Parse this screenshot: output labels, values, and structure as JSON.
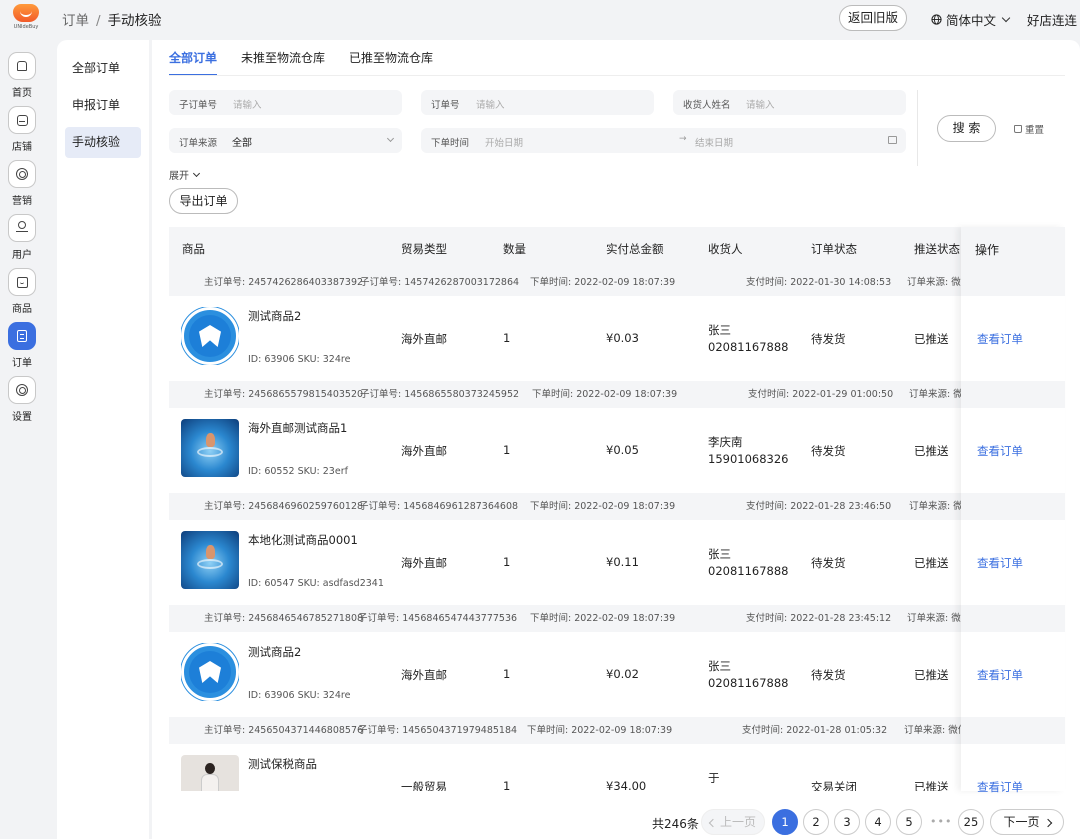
{
  "header": {
    "logo_text": "UNIdeBuy",
    "breadcrumb": [
      "订单",
      "手动核验"
    ],
    "old_version_label": "返回旧版",
    "language_label": "简体中文",
    "store_label": "好店连连"
  },
  "rail": {
    "items": [
      {
        "label": "首页",
        "icon": "house-icon"
      },
      {
        "label": "店铺",
        "icon": "store-icon"
      },
      {
        "label": "营销",
        "icon": "target-icon"
      },
      {
        "label": "用户",
        "icon": "user-icon"
      },
      {
        "label": "商品",
        "icon": "bag-icon"
      },
      {
        "label": "订单",
        "icon": "order-icon",
        "active": true
      },
      {
        "label": "设置",
        "icon": "settings-icon"
      }
    ]
  },
  "subnav": {
    "items": [
      "全部订单",
      "申报订单",
      "手动核验"
    ],
    "active_index": 2
  },
  "tabs": [
    "全部订单",
    "未推至物流仓库",
    "已推至物流仓库"
  ],
  "filters": {
    "sub_order_label": "子订单号",
    "sub_order_placeholder": "请输入",
    "order_label": "订单号",
    "order_placeholder": "请输入",
    "receiver_label": "收货人姓名",
    "receiver_placeholder": "请输入",
    "source_label": "订单来源",
    "source_value": "全部",
    "time_label": "下单时间",
    "start_placeholder": "开始日期",
    "end_placeholder": "结束日期",
    "range_arrow": "→",
    "search_label": "搜 索",
    "reset_label": "重置",
    "expand_label": "展开",
    "export_label": "导出订单"
  },
  "table": {
    "columns": [
      "商品",
      "贸易类型",
      "数量",
      "实付总金额",
      "收货人",
      "订单状态",
      "推送状态",
      "操作"
    ],
    "orders": [
      {
        "meta": {
          "main": "主订单号: 2457426286403387392",
          "sub": "子订单号: 1457426287003172864",
          "created": "下单时间: 2022-02-09 18:07:39",
          "paid": "支付时间: 2022-01-30 14:08:53",
          "source": "订单来源: 微信"
        },
        "product": "测试商品2",
        "thumb": "shield",
        "ids": "ID: 63906  SKU: 324re",
        "trade": "海外直邮",
        "qty": "1",
        "amount": "¥0.03",
        "receiver_name": "张三",
        "receiver_phone": "02081167888",
        "status": "待发货",
        "push": "已推送",
        "action": "查看订单"
      },
      {
        "meta": {
          "main": "主订单号: 2456865579815403520",
          "sub": "子订单号: 1456865580373245952",
          "created": "下单时间: 2022-02-09 18:07:39",
          "paid": "支付时间: 2022-01-29 01:00:50",
          "source": "订单来源: 微信"
        },
        "product": "海外直邮测试商品1",
        "thumb": "water",
        "ids": "ID: 60552  SKU: 23erf",
        "trade": "海外直邮",
        "qty": "1",
        "amount": "¥0.05",
        "receiver_name": "李庆南",
        "receiver_phone": "15901068326",
        "status": "待发货",
        "push": "已推送",
        "action": "查看订单"
      },
      {
        "meta": {
          "main": "主订单号: 2456846960259760128",
          "sub": "子订单号: 1456846961287364608",
          "created": "下单时间: 2022-02-09 18:07:39",
          "paid": "支付时间: 2022-01-28 23:46:50",
          "source": "订单来源: 微信"
        },
        "product": "本地化测试商品0001",
        "thumb": "water",
        "ids": "ID: 60547  SKU: asdfasd2341",
        "trade": "海外直邮",
        "qty": "1",
        "amount": "¥0.11",
        "receiver_name": "张三",
        "receiver_phone": "02081167888",
        "status": "待发货",
        "push": "已推送",
        "action": "查看订单"
      },
      {
        "meta": {
          "main": "主订单号: 2456846546785271808",
          "sub": "子订单号: 1456846547443777536",
          "created": "下单时间: 2022-02-09 18:07:39",
          "paid": "支付时间: 2022-01-28 23:45:12",
          "source": "订单来源: 微信"
        },
        "product": "测试商品2",
        "thumb": "shield",
        "ids": "ID: 63906  SKU: 324re",
        "trade": "海外直邮",
        "qty": "1",
        "amount": "¥0.02",
        "receiver_name": "张三",
        "receiver_phone": "02081167888",
        "status": "待发货",
        "push": "已推送",
        "action": "查看订单"
      },
      {
        "meta": {
          "main": "主订单号: 2456504371446808576",
          "sub": "子订单号: 1456504371979485184",
          "created": "下单时间: 2022-02-09 18:07:39",
          "paid": "支付时间: 2022-01-28 01:05:32",
          "source": "订单来源: 微信"
        },
        "product": "测试保税商品",
        "thumb": "person",
        "ids": "",
        "trade": "一般贸易",
        "qty": "1",
        "amount": "¥34.00",
        "receiver_name": "于",
        "receiver_phone": "",
        "status": "交易关闭",
        "push": "已推送",
        "action": "查看订单"
      }
    ]
  },
  "pagination": {
    "total_label": "共246条",
    "prev_label": "上一页",
    "next_label": "下一页",
    "pages": [
      "1",
      "2",
      "3",
      "4",
      "5"
    ],
    "ellipsis": "•••",
    "last_page": "25",
    "current": "1"
  },
  "colors": {
    "accent": "#3b6fe0",
    "background": "#f2f3f5"
  }
}
